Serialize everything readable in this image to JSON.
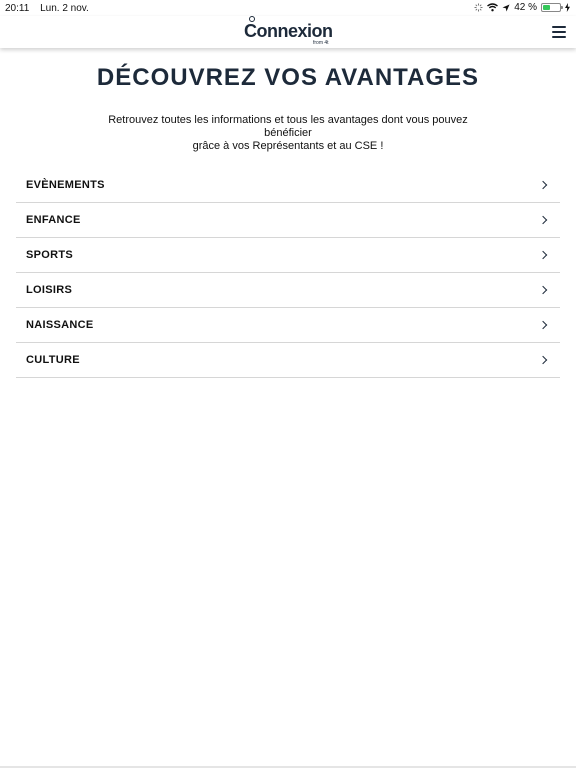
{
  "status_bar": {
    "time": "20:11",
    "date": "Lun. 2 nov.",
    "battery_percent": "42 %",
    "battery_level": 0.42,
    "icons": [
      "activity-icon",
      "wifi-icon",
      "location-icon",
      "battery-icon",
      "charging-icon"
    ]
  },
  "header": {
    "logo_text": "Connexion",
    "logo_subtext": "from 4t",
    "menu_icon": "hamburger-menu-icon"
  },
  "main": {
    "title": "DÉCOUVREZ VOS AVANTAGES",
    "intro_line1": "Retrouvez toutes les informations et tous les avantages dont vous pouvez bénéficier",
    "intro_line2": "grâce à vos Représentants et au CSE !",
    "items": [
      {
        "label": "EVÈNEMENTS"
      },
      {
        "label": "ENFANCE"
      },
      {
        "label": "SPORTS"
      },
      {
        "label": "LOISIRS"
      },
      {
        "label": "NAISSANCE"
      },
      {
        "label": "CULTURE"
      }
    ]
  },
  "colors": {
    "primary": "#1d2a3a",
    "divider": "#d6d6d6",
    "battery": "#34c759"
  }
}
